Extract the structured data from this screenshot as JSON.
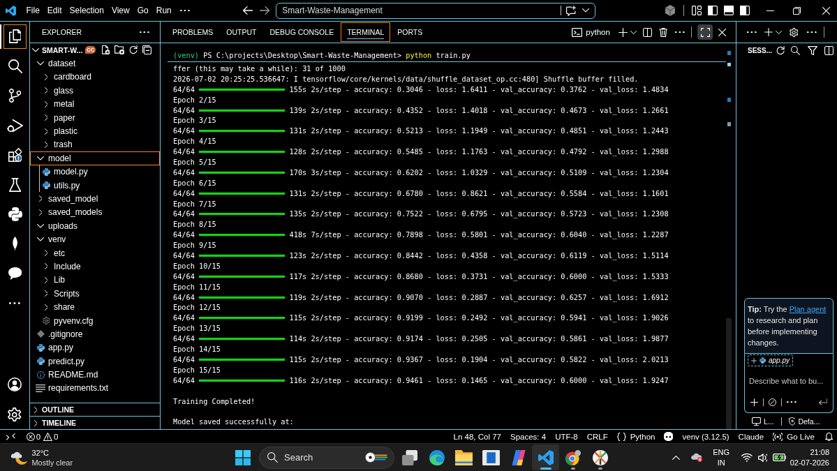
{
  "title_bar": {
    "menu": [
      "File",
      "Edit",
      "Selection",
      "View",
      "Go",
      "Run"
    ],
    "command_center": "Smart-Waste-Management"
  },
  "activity_bar": {
    "items": [
      {
        "selected": true
      },
      {
        "selected": false
      },
      {
        "selected": false
      },
      {
        "selected": false
      },
      {
        "selected": false
      },
      {
        "selected": false
      },
      {
        "selected": false
      },
      {
        "selected": false
      },
      {
        "selected": false
      }
    ]
  },
  "explorer": {
    "title": "EXPLORER",
    "root": {
      "name": "SMART-W...",
      "badge": "CC",
      "expanded": true
    },
    "tree": [
      {
        "name": "dataset",
        "kind": "folder",
        "expanded": true,
        "selected": false,
        "children": [
          {
            "name": "cardboard",
            "kind": "folder",
            "expanded": false,
            "selected": false
          },
          {
            "name": "glass",
            "kind": "folder",
            "expanded": false,
            "selected": false
          },
          {
            "name": "metal",
            "kind": "folder",
            "expanded": false,
            "selected": false
          },
          {
            "name": "paper",
            "kind": "folder",
            "expanded": false,
            "selected": false
          },
          {
            "name": "plastic",
            "kind": "folder",
            "expanded": false,
            "selected": false
          },
          {
            "name": "trash",
            "kind": "folder",
            "expanded": false,
            "selected": false
          }
        ]
      },
      {
        "name": "model",
        "kind": "folder",
        "expanded": true,
        "selected": true,
        "children": [
          {
            "name": "model.py",
            "kind": "python",
            "selected": false
          },
          {
            "name": "utils.py",
            "kind": "python",
            "selected": false
          }
        ]
      },
      {
        "name": "saved_model",
        "kind": "folder",
        "expanded": false,
        "selected": false
      },
      {
        "name": "saved_models",
        "kind": "folder",
        "expanded": false,
        "selected": false
      },
      {
        "name": "uploads",
        "kind": "folder",
        "expanded": true,
        "selected": false
      },
      {
        "name": "venv",
        "kind": "folder",
        "expanded": true,
        "selected": false,
        "children": [
          {
            "name": "etc",
            "kind": "folder",
            "expanded": false,
            "selected": false
          },
          {
            "name": "Include",
            "kind": "folder",
            "expanded": false,
            "selected": false
          },
          {
            "name": "Lib",
            "kind": "folder",
            "expanded": false,
            "selected": false
          },
          {
            "name": "Scripts",
            "kind": "folder",
            "expanded": false,
            "selected": false
          },
          {
            "name": "share",
            "kind": "folder",
            "expanded": false,
            "selected": false
          },
          {
            "name": "pyvenv.cfg",
            "kind": "config",
            "selected": false
          }
        ]
      },
      {
        "name": ".gitignore",
        "kind": "git",
        "selected": false
      },
      {
        "name": "app.py",
        "kind": "python",
        "selected": false
      },
      {
        "name": "predict.py",
        "kind": "python",
        "selected": false
      },
      {
        "name": "README.md",
        "kind": "info",
        "selected": false
      },
      {
        "name": "requirements.txt",
        "kind": "text",
        "selected": false
      }
    ],
    "sections": [
      {
        "label": "OUTLINE",
        "expanded": false
      },
      {
        "label": "TIMELINE",
        "expanded": false
      }
    ]
  },
  "panel": {
    "tabs": [
      {
        "label": "PROBLEMS",
        "selected": false
      },
      {
        "label": "OUTPUT",
        "selected": false
      },
      {
        "label": "DEBUG CONSOLE",
        "selected": false
      },
      {
        "label": "TERMINAL",
        "selected": true
      },
      {
        "label": "PORTS",
        "selected": false
      }
    ],
    "terminal_name": "python"
  },
  "terminal": {
    "sticky_command": {
      "env": "(venv)",
      "prompt": "PS C:\\projects\\Desktop\\Smart-Waste-Management>",
      "command": "python",
      "args": "train.py"
    },
    "lines": [
      {
        "kind": "text",
        "text": "ffer (this may take a while): 31 of 1000"
      },
      {
        "kind": "text",
        "text": "2026-07-02 20:25:25.536647: I tensorflow/core/kernels/data/shuffle_dataset_op.cc:480] Shuffle buffer filled."
      },
      {
        "kind": "progress",
        "steps": "64/64",
        "level": 1,
        "stats": "155s 2s/step - accuracy: 0.3046 - loss: 1.6411 - val_accuracy: 0.3762 - val_loss: 1.4834"
      },
      {
        "kind": "text",
        "text": "Epoch 2/15"
      },
      {
        "kind": "progress",
        "steps": "64/64",
        "level": 1,
        "stats": "139s 2s/step - accuracy: 0.4352 - loss: 1.4018 - val_accuracy: 0.4673 - val_loss: 1.2661"
      },
      {
        "kind": "text",
        "text": "Epoch 3/15"
      },
      {
        "kind": "progress",
        "steps": "64/64",
        "level": 1,
        "stats": "131s 2s/step - accuracy: 0.5213 - loss: 1.1949 - val_accuracy: 0.4851 - val_loss: 1.2443"
      },
      {
        "kind": "text",
        "text": "Epoch 4/15"
      },
      {
        "kind": "progress",
        "steps": "64/64",
        "level": 1,
        "stats": "128s 2s/step - accuracy: 0.5485 - loss: 1.1763 - val_accuracy: 0.4792 - val_loss: 1.2988"
      },
      {
        "kind": "text",
        "text": "Epoch 5/15"
      },
      {
        "kind": "progress",
        "steps": "64/64",
        "level": 1,
        "stats": "170s 3s/step - accuracy: 0.6202 - loss: 1.0329 - val_accuracy: 0.5109 - val_loss: 1.2304"
      },
      {
        "kind": "text",
        "text": "Epoch 6/15"
      },
      {
        "kind": "progress",
        "steps": "64/64",
        "level": 1,
        "stats": "131s 2s/step - accuracy: 0.6780 - loss: 0.8621 - val_accuracy: 0.5584 - val_loss: 1.1601"
      },
      {
        "kind": "text",
        "text": "Epoch 7/15"
      },
      {
        "kind": "progress",
        "steps": "64/64",
        "level": 1,
        "stats": "135s 2s/step - accuracy: 0.7522 - loss: 0.6795 - val_accuracy: 0.5723 - val_loss: 1.2308"
      },
      {
        "kind": "text",
        "text": "Epoch 8/15"
      },
      {
        "kind": "progress",
        "steps": "64/64",
        "level": 1,
        "stats": "418s 7s/step - accuracy: 0.7898 - loss: 0.5801 - val_accuracy: 0.6040 - val_loss: 1.2287"
      },
      {
        "kind": "text",
        "text": "Epoch 9/15"
      },
      {
        "kind": "progress",
        "steps": "64/64",
        "level": 1,
        "stats": "123s 2s/step - accuracy: 0.8442 - loss: 0.4358 - val_accuracy: 0.6119 - val_loss: 1.5114"
      },
      {
        "kind": "text",
        "text": "Epoch 10/15"
      },
      {
        "kind": "progress",
        "steps": "64/64",
        "level": 1,
        "stats": "117s 2s/step - accuracy: 0.8680 - loss: 0.3731 - val_accuracy: 0.6000 - val_loss: 1.5333"
      },
      {
        "kind": "text",
        "text": "Epoch 11/15"
      },
      {
        "kind": "progress",
        "steps": "64/64",
        "level": 1,
        "stats": "119s 2s/step - accuracy: 0.9070 - loss: 0.2887 - val_accuracy: 0.6257 - val_loss: 1.6912"
      },
      {
        "kind": "text",
        "text": "Epoch 12/15"
      },
      {
        "kind": "progress",
        "steps": "64/64",
        "level": 1,
        "stats": "115s 2s/step - accuracy: 0.9199 - loss: 0.2492 - val_accuracy: 0.5941 - val_loss: 1.9026"
      },
      {
        "kind": "text",
        "text": "Epoch 13/15"
      },
      {
        "kind": "progress",
        "steps": "64/64",
        "level": 1,
        "stats": "114s 2s/step - accuracy: 0.9174 - loss: 0.2505 - val_accuracy: 0.5861 - val_loss: 1.9877"
      },
      {
        "kind": "text",
        "text": "Epoch 14/15"
      },
      {
        "kind": "progress",
        "steps": "64/64",
        "level": 1,
        "stats": "115s 2s/step - accuracy: 0.9367 - loss: 0.1904 - val_accuracy: 0.5822 - val_loss: 2.0213"
      },
      {
        "kind": "text",
        "text": "Epoch 15/15"
      },
      {
        "kind": "progress",
        "steps": "64/64",
        "level": 1,
        "stats": "116s 2s/step - accuracy: 0.9461 - loss: 0.1465 - val_accuracy: 0.6000 - val_loss: 1.9247"
      },
      {
        "kind": "blank"
      },
      {
        "kind": "text",
        "text": "Training Completed!"
      },
      {
        "kind": "blank"
      },
      {
        "kind": "text",
        "text": "Model saved successfully at:"
      }
    ]
  },
  "chat": {
    "title": "SESS...",
    "tip": {
      "text": "**Tip:** Try the",
      "link": "Plan agent",
      "text_after": "to research and plan before implementing changes."
    },
    "attachment": "app.py",
    "placeholder": "Describe what to bu...",
    "footer": [
      "L...",
      "Defa..."
    ]
  },
  "status_bar": {
    "errors": "0",
    "warnings": "0",
    "position": "Ln 48, Col 77",
    "indentation": "Spaces: 4",
    "encoding": "UTF-8",
    "line_ending": "CRLF",
    "language": "Python",
    "interpreter": "venv (3.12.5)",
    "model": "Claude",
    "live_server": "Go Live"
  },
  "taskbar": {
    "weather": {
      "temperature": "32°C",
      "condition": "Mostly clear"
    },
    "search": {
      "placeholder": "Search"
    },
    "apps": [
      {
        "selected": false,
        "running": false
      },
      {
        "selected": false,
        "running": false
      },
      {
        "selected": false,
        "running": false
      },
      {
        "selected": false,
        "running": false
      },
      {
        "selected": false,
        "running": false
      },
      {
        "selected": true,
        "running": true
      },
      {
        "selected": false,
        "running": true
      },
      {
        "selected": false,
        "running": true
      }
    ],
    "language": {
      "input": "ENG",
      "region": "IN"
    },
    "time": "21:08",
    "date": "02-07-2026"
  }
}
